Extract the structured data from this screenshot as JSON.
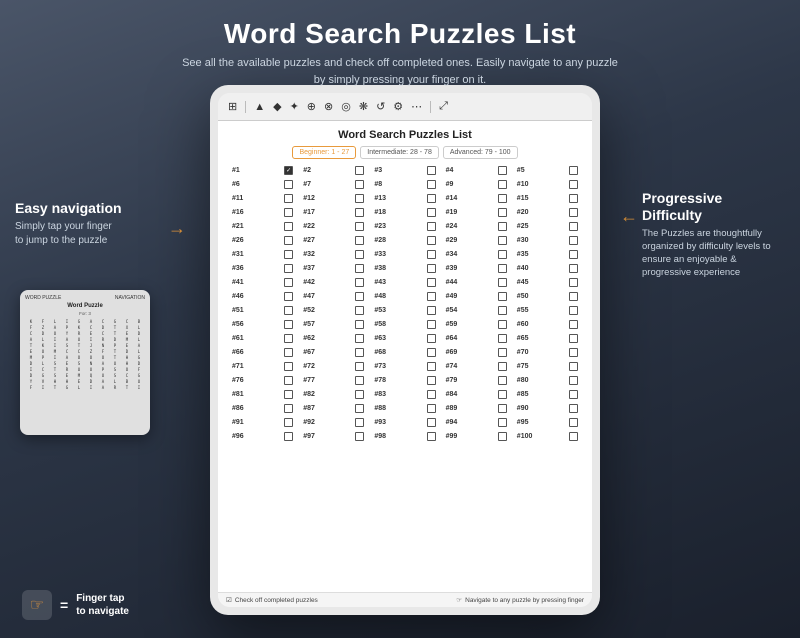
{
  "header": {
    "title": "Word Search Puzzles List",
    "subtitle_line1": "See all the available puzzles and check off completed ones. Easily navigate to any puzzle",
    "subtitle_line2": "by simply pressing your finger on it."
  },
  "device": {
    "doc_title": "Word Search Puzzles List",
    "difficulty_tabs": [
      {
        "label": "Beginner: 1 - 27",
        "class": "beginner"
      },
      {
        "label": "Intermediate: 28 - 78",
        "class": "intermediate"
      },
      {
        "label": "Advanced: 79 - 100",
        "class": "advanced"
      }
    ],
    "puzzles": [
      "#1",
      "#2",
      "#3",
      "#4",
      "#5",
      "#6",
      "#7",
      "#8",
      "#9",
      "#10",
      "#11",
      "#12",
      "#13",
      "#14",
      "#15",
      "#16",
      "#17",
      "#18",
      "#19",
      "#20",
      "#21",
      "#22",
      "#23",
      "#24",
      "#25",
      "#26",
      "#27",
      "#28",
      "#29",
      "#30",
      "#31",
      "#32",
      "#33",
      "#34",
      "#35",
      "#36",
      "#37",
      "#38",
      "#39",
      "#40",
      "#41",
      "#42",
      "#43",
      "#44",
      "#45",
      "#46",
      "#47",
      "#48",
      "#49",
      "#50",
      "#51",
      "#52",
      "#53",
      "#54",
      "#55",
      "#56",
      "#57",
      "#58",
      "#59",
      "#60",
      "#61",
      "#62",
      "#63",
      "#64",
      "#65",
      "#66",
      "#67",
      "#68",
      "#69",
      "#70",
      "#71",
      "#72",
      "#73",
      "#74",
      "#75",
      "#76",
      "#77",
      "#78",
      "#79",
      "#80",
      "#81",
      "#82",
      "#83",
      "#84",
      "#85",
      "#86",
      "#87",
      "#88",
      "#89",
      "#90",
      "#91",
      "#92",
      "#93",
      "#94",
      "#95",
      "#96",
      "#97",
      "#98",
      "#99",
      "#100"
    ],
    "checked": [
      "#1"
    ],
    "footer_left": "☑ Check off completed puzzles",
    "footer_right": "☞ Navigate to any puzzle by pressing finger"
  },
  "annotation_left": {
    "title": "Easy navigation",
    "text": "Simply tap your finger\nto jump to the puzzle"
  },
  "annotation_right": {
    "title": "Progressive\nDifficulty",
    "text": "The Puzzles are thoughtfully organized by difficulty levels to ensure an enjoyable & progressive experience"
  },
  "finger_note": {
    "icon": "☞",
    "equals": "=",
    "label": "Finger tap\nto navigate"
  },
  "mini_device": {
    "header_left": "WORD PUZZLE",
    "header_right": "NAVIGATION",
    "title": "Word Puzzle",
    "subtitle": "For: 3",
    "grid_letters": [
      "K",
      "F",
      "L",
      "I",
      "G",
      "A",
      "C",
      "G",
      "C",
      "B",
      "F",
      "Z",
      "A",
      "P",
      "K",
      "C",
      "D",
      "T",
      "X",
      "L",
      "C",
      "D",
      "O",
      "Y",
      "R",
      "E",
      "C",
      "E",
      "T",
      "T",
      "A",
      "L",
      "I",
      "A",
      "U",
      "I",
      "D",
      "M",
      "L",
      "T",
      "K",
      "I",
      "K",
      "S",
      "T",
      "J",
      "N",
      "P",
      "E",
      "A",
      "E",
      "O",
      "M",
      "C",
      "C",
      "Z",
      "F",
      "T",
      "D",
      "L",
      "M",
      "P",
      "A",
      "I",
      "O",
      "O",
      "O",
      "T",
      "H",
      "G",
      "D",
      "L",
      "S",
      "E",
      "S",
      "N",
      "A",
      "U",
      "H",
      "D",
      "I",
      "C",
      "T",
      "R",
      "U",
      "U",
      "P",
      "S",
      "O",
      "F",
      "D",
      "G",
      "S",
      "E",
      "M",
      "U",
      "Q",
      "S",
      "C",
      "G",
      "Y",
      "V",
      "H",
      "H",
      "E",
      "D",
      "A",
      "L",
      "B",
      "G",
      "U",
      "F",
      "I",
      "T",
      "G",
      "L",
      "I",
      "A",
      "R",
      "T",
      "E"
    ]
  },
  "toolbar_icons": [
    "⊞",
    "▲",
    "◆",
    "✦",
    "⊕",
    "⊗",
    "◎",
    "❋",
    "↺",
    "⚙",
    "⋯",
    "⤢"
  ]
}
